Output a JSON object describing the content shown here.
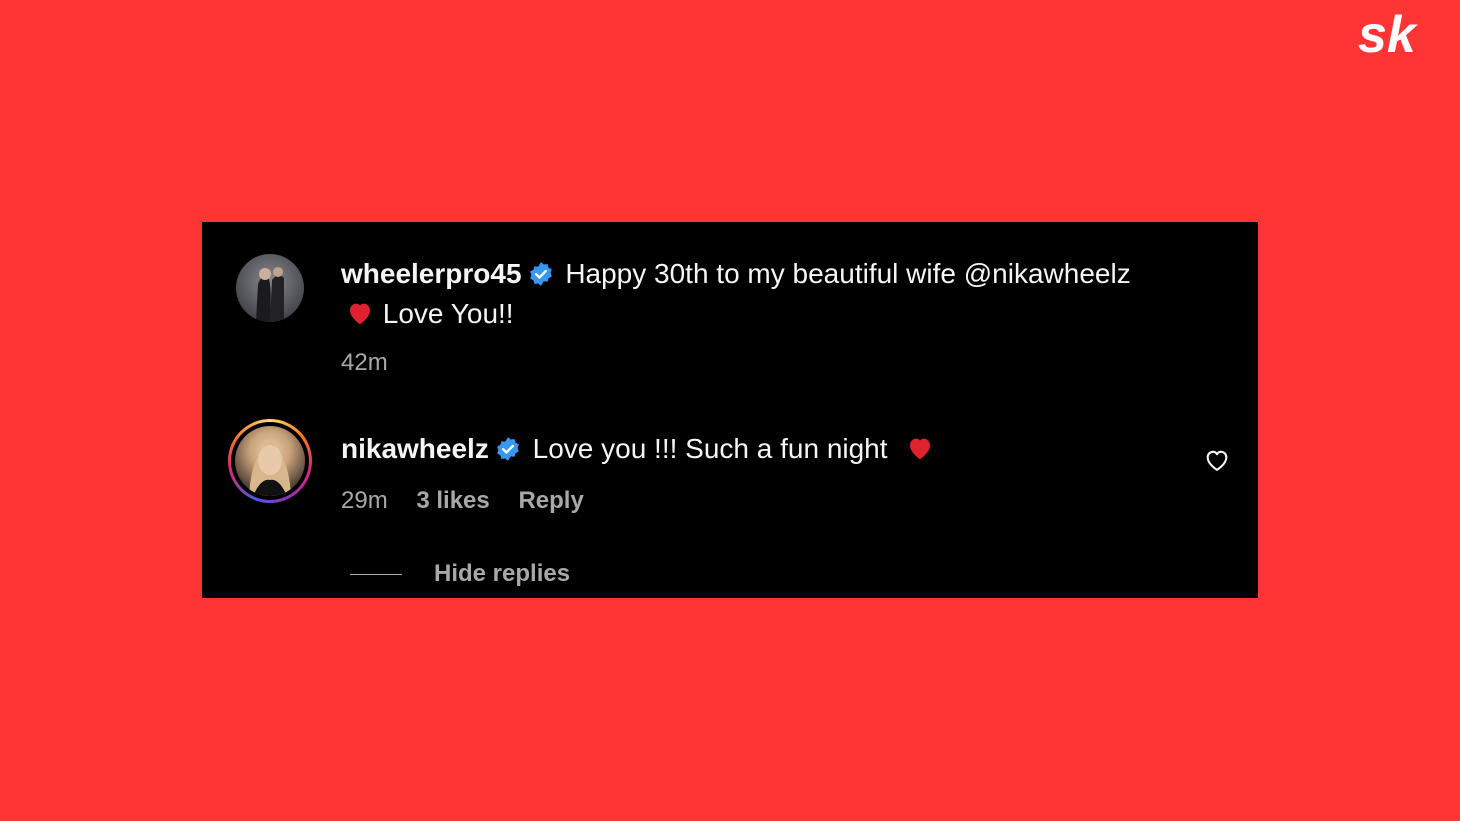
{
  "brand": {
    "logo_text": "sk"
  },
  "colors": {
    "background": "#ff3434",
    "card": "#000000",
    "text": "#f5f5f5",
    "muted": "#a8a8a8",
    "verified": "#3897f0",
    "heart": "#e0222f"
  },
  "comments": [
    {
      "username": "wheelerpro45",
      "verified": true,
      "text_line1": "Happy 30th to my beautiful wife @nikawheelz",
      "text_line2": "Love You!!",
      "time": "42m"
    },
    {
      "username": "nikawheelz",
      "verified": true,
      "text": "Love you !!! Such a fun night",
      "time": "29m",
      "likes": "3 likes",
      "reply_label": "Reply"
    }
  ],
  "replies_toggle": {
    "label": "Hide replies"
  },
  "icons": [
    "verified-badge-icon",
    "red-heart-emoji",
    "heart-outline-icon"
  ]
}
